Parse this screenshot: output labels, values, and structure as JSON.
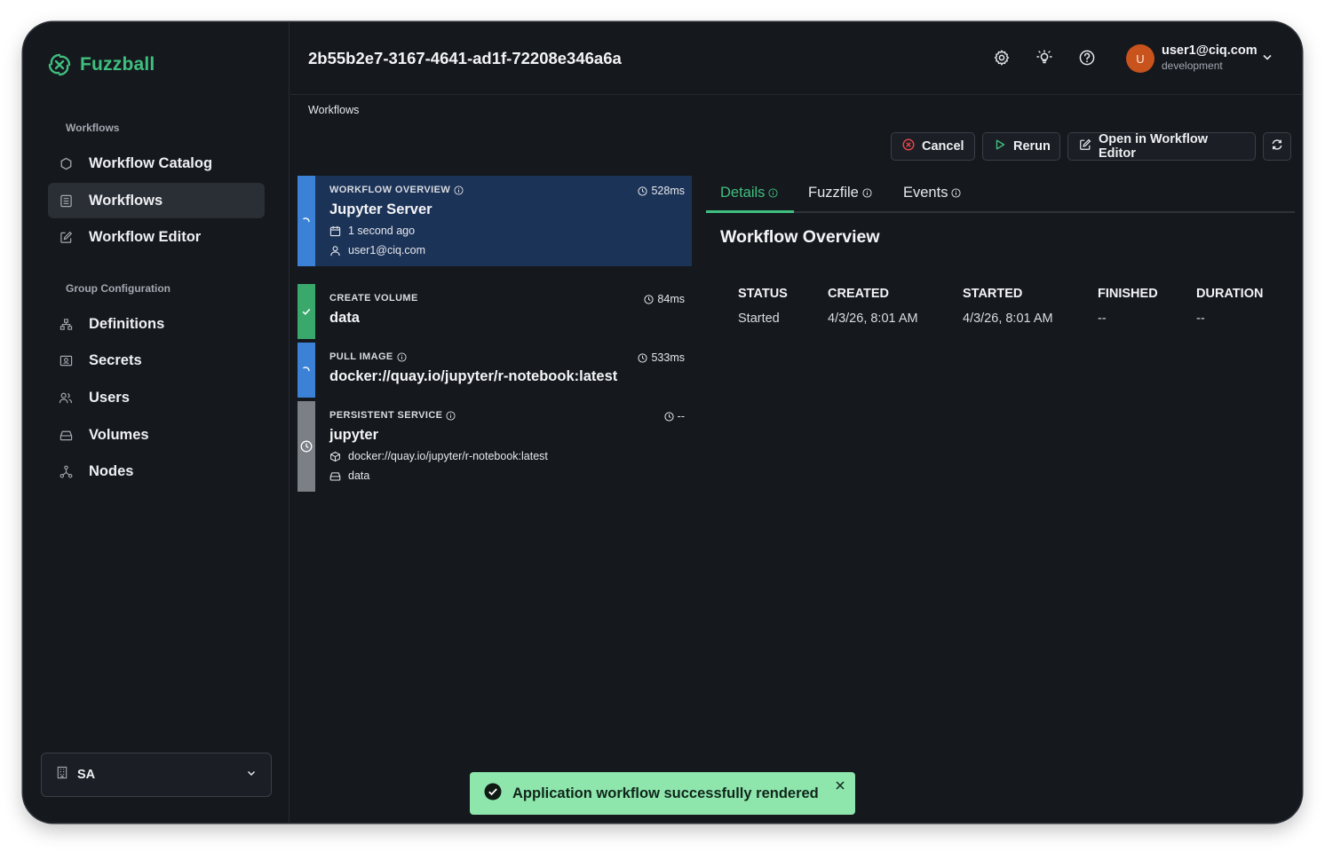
{
  "app": {
    "brand": "Fuzzball",
    "brand_color": "#3fbf7f"
  },
  "sidebar": {
    "section_workflows": "Workflows",
    "section_group": "Group Configuration",
    "items": [
      {
        "label": "Workflow Catalog",
        "icon": "hexagon-icon"
      },
      {
        "label": "Workflows",
        "icon": "list-icon",
        "active": true
      },
      {
        "label": "Workflow Editor",
        "icon": "edit-icon"
      },
      {
        "label": "Definitions",
        "icon": "hierarchy-icon"
      },
      {
        "label": "Secrets",
        "icon": "secret-icon"
      },
      {
        "label": "Users",
        "icon": "users-icon"
      },
      {
        "label": "Volumes",
        "icon": "drive-icon"
      },
      {
        "label": "Nodes",
        "icon": "nodes-icon"
      }
    ],
    "org_select": {
      "value": "SA",
      "icon": "building-icon"
    }
  },
  "header": {
    "title": "2b55b2e7-3167-4641-ad1f-72208e346a6a",
    "user": {
      "initial": "U",
      "email": "user1@ciq.com",
      "environment": "development"
    }
  },
  "breadcrumb": "Workflows",
  "actions": {
    "cancel": "Cancel",
    "rerun": "Rerun",
    "open_editor": "Open in Workflow Editor"
  },
  "steps": [
    {
      "type": "WORKFLOW OVERVIEW",
      "name": "Jupyter Server",
      "time": "528ms",
      "created": "1 second ago",
      "user": "user1@ciq.com",
      "status": "running"
    },
    {
      "type": "CREATE VOLUME",
      "name": "data",
      "time": "84ms",
      "status": "success"
    },
    {
      "type": "PULL IMAGE",
      "name": "docker://quay.io/jupyter/r-notebook:latest",
      "time": "533ms",
      "status": "running"
    },
    {
      "type": "PERSISTENT SERVICE",
      "name": "jupyter",
      "time": "--",
      "image": "docker://quay.io/jupyter/r-notebook:latest",
      "volume": "data",
      "status": "pending"
    }
  ],
  "tabs": [
    {
      "label": "Details",
      "active": true
    },
    {
      "label": "Fuzzfile"
    },
    {
      "label": "Events"
    }
  ],
  "overview": {
    "title": "Workflow Overview",
    "columns": [
      "STATUS",
      "CREATED",
      "STARTED",
      "FINISHED",
      "DURATION"
    ],
    "values": [
      "Started",
      "4/3/26, 8:01 AM",
      "4/3/26, 8:01 AM",
      "--",
      "--"
    ]
  },
  "toast": {
    "message": "Application workflow successfully rendered"
  },
  "colors": {
    "running": "#3b82d6",
    "success": "#3aa86b",
    "pending": "#7b7f86",
    "selected_card": "#1c3358"
  }
}
